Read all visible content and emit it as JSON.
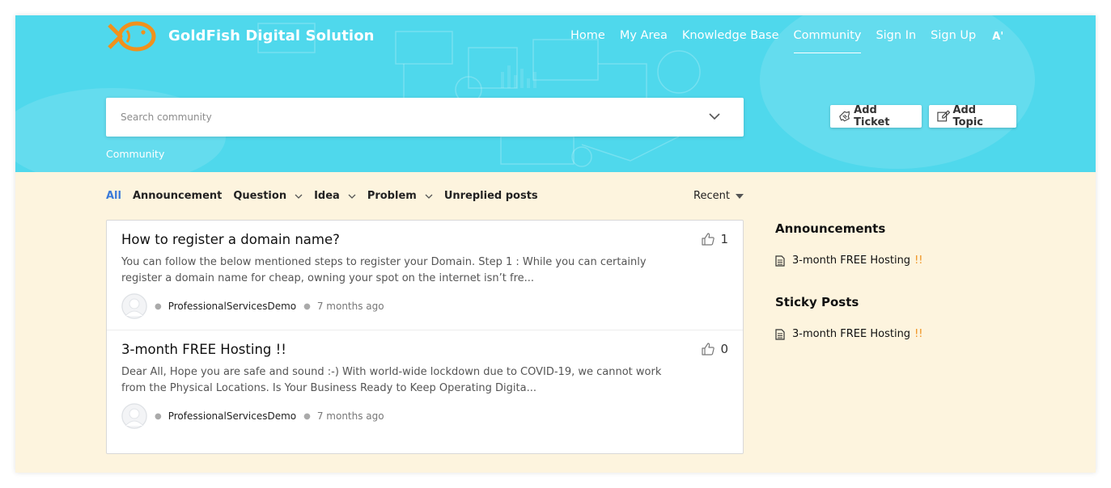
{
  "brand": {
    "name": "GoldFish Digital Solution",
    "logo_icon": "goldfish-icon",
    "logo_color": "#f0911c"
  },
  "nav": {
    "items": [
      {
        "label": "Home"
      },
      {
        "label": "My Area"
      },
      {
        "label": "Knowledge Base"
      },
      {
        "label": "Community",
        "active": true
      },
      {
        "label": "Sign In"
      },
      {
        "label": "Sign Up"
      }
    ],
    "font_toggle": "A'"
  },
  "search": {
    "placeholder": "Search community"
  },
  "actions": {
    "add_ticket": "Add Ticket",
    "add_topic": "Add Topic"
  },
  "breadcrumb": "Community",
  "filters": {
    "items": [
      {
        "label": "All",
        "active": true
      },
      {
        "label": "Announcement"
      },
      {
        "label": "Question",
        "dropdown": true
      },
      {
        "label": "Idea",
        "dropdown": true
      },
      {
        "label": "Problem",
        "dropdown": true
      },
      {
        "label": "Unreplied posts"
      }
    ],
    "sort": "Recent"
  },
  "posts": [
    {
      "title": "How to register a domain name?",
      "excerpt": "You can follow the below mentioned steps to register your Domain. Step 1 : While you can certainly register a domain name for cheap, owning your spot on the internet isn’t fre...",
      "author": "ProfessionalServicesDemo",
      "time": "7 months ago",
      "likes": "1"
    },
    {
      "title": "3-month FREE Hosting !!",
      "excerpt": "Dear All, Hope you are safe and sound :-) With world-wide lockdown due to COVID-19, we cannot work from the Physical Locations. Is Your Business Ready to Keep Operating Digita...",
      "author": "ProfessionalServicesDemo",
      "time": "7 months ago",
      "likes": "0"
    }
  ],
  "sidebar": {
    "announcements_title": "Announcements",
    "announcements": [
      {
        "label": "3-month FREE Hosting",
        "suffix": "!!"
      }
    ],
    "sticky_title": "Sticky Posts",
    "sticky": [
      {
        "label": "3-month FREE Hosting",
        "suffix": "!!"
      }
    ]
  },
  "colors": {
    "hero": "#4fd8ec",
    "page_bg": "#fdf4de",
    "accent": "#3b7bd9",
    "suffix_accent": "#f0911c"
  }
}
